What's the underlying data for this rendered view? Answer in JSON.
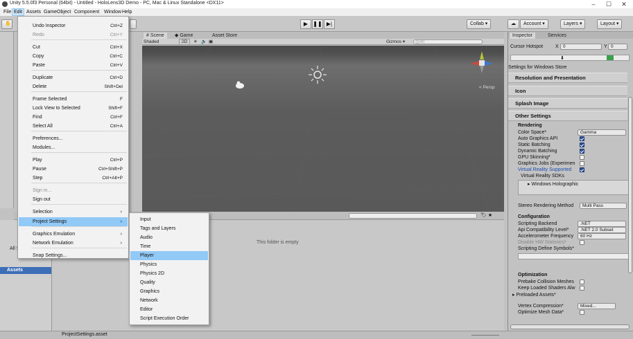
{
  "window": {
    "title": "Unity 5.5.0f3 Personal (64bit) - Untitled - HoloLens3D Demo - PC, Mac & Linux Standalone <DX11>",
    "minimize": "–",
    "maximize": "☐",
    "close": "✕"
  },
  "menubar": [
    "File",
    "Edit",
    "Assets",
    "GameObject",
    "Component",
    "Window",
    "Help"
  ],
  "toolbar": {
    "play": "▶",
    "pause": "❚❚",
    "step": "▶|",
    "collab": "Collab ▾",
    "cloud": "☁",
    "account": "Account ▾",
    "layers": "Layers ▾",
    "layout": "Layout ▾"
  },
  "scene": {
    "tabs": [
      "# Scene",
      "◆ Game",
      "Asset Store"
    ],
    "shading": "Shaded",
    "mode_2d": "2D",
    "gizmos": "Gizmos ▾",
    "search_placeholder": "◎All",
    "persp": "< Persp"
  },
  "project": {
    "empty_text": "This folder is empty",
    "assets_label": "Assets",
    "favorites_item": "All Scripts",
    "status_file": "ProjectSettings.asset"
  },
  "edit_menu": {
    "items": [
      {
        "label": "Undo Inspector",
        "shortcut": "Ctrl+Z",
        "disabled": false
      },
      {
        "label": "Redo",
        "shortcut": "Ctrl+Y",
        "disabled": true
      },
      {
        "label": "Cut",
        "shortcut": "Ctrl+X",
        "disabled": false
      },
      {
        "label": "Copy",
        "shortcut": "Ctrl+C",
        "disabled": false
      },
      {
        "label": "Paste",
        "shortcut": "Ctrl+V",
        "disabled": false
      },
      {
        "label": "Duplicate",
        "shortcut": "Ctrl+D",
        "disabled": false
      },
      {
        "label": "Delete",
        "shortcut": "Shift+Del",
        "disabled": false
      },
      {
        "label": "Frame Selected",
        "shortcut": "F",
        "disabled": false
      },
      {
        "label": "Lock View to Selected",
        "shortcut": "Shift+F",
        "disabled": false
      },
      {
        "label": "Find",
        "shortcut": "Ctrl+F",
        "disabled": false
      },
      {
        "label": "Select All",
        "shortcut": "Ctrl+A",
        "disabled": false
      },
      {
        "label": "Preferences...",
        "shortcut": "",
        "disabled": false
      },
      {
        "label": "Modules...",
        "shortcut": "",
        "disabled": false
      },
      {
        "label": "Play",
        "shortcut": "Ctrl+P",
        "disabled": false
      },
      {
        "label": "Pause",
        "shortcut": "Ctrl+Shift+P",
        "disabled": false
      },
      {
        "label": "Step",
        "shortcut": "Ctrl+Alt+P",
        "disabled": false
      },
      {
        "label": "Sign in...",
        "shortcut": "",
        "disabled": true
      },
      {
        "label": "Sign out",
        "shortcut": "",
        "disabled": false
      },
      {
        "label": "Selection",
        "shortcut": "",
        "disabled": false,
        "submenu": true
      },
      {
        "label": "Project Settings",
        "shortcut": "",
        "disabled": false,
        "submenu": true,
        "hover": true
      },
      {
        "label": "Graphics Emulation",
        "shortcut": "",
        "disabled": false,
        "submenu": true
      },
      {
        "label": "Network Emulation",
        "shortcut": "",
        "disabled": false,
        "submenu": true
      },
      {
        "label": "Snap Settings...",
        "shortcut": "",
        "disabled": false
      }
    ]
  },
  "project_settings_menu": {
    "items": [
      "Input",
      "Tags and Layers",
      "Audio",
      "Time",
      "Player",
      "Physics",
      "Physics 2D",
      "Quality",
      "Graphics",
      "Network",
      "Editor",
      "Script Execution Order"
    ],
    "hover_index": 4
  },
  "inspector": {
    "tabs": [
      "Inspector",
      "Services"
    ],
    "cursor_hotspot": "Cursor Hotspot",
    "x_label": "X",
    "x_value": "0",
    "y_label": "Y",
    "y_value": "0",
    "settings_for": "Settings for Windows Store",
    "sections": {
      "resolution": "Resolution and Presentation",
      "icon": "Icon",
      "splash": "Splash Image",
      "other": "Other Settings"
    },
    "rendering": "Rendering",
    "color_space": "Color Space*",
    "color_space_value": "Gamma",
    "auto_graphics": "Auto Graphics API",
    "static_batching": "Static Batching",
    "dynamic_batching": "Dynamic Batching",
    "gpu_skinning": "GPU Skinning*",
    "graphics_jobs": "Graphics Jobs (Experimen",
    "vr_supported": "Virtual Reality Supported",
    "vr_sdks": "Virtual Reality SDKs",
    "windows_holographic": "▸ Windows Holographic",
    "stereo_method": "Stereo Rendering Method",
    "stereo_value": "Multi Pass",
    "configuration": "Configuration",
    "scripting_backend": "Scripting Backend",
    "scripting_backend_value": ".NET",
    "api_compat": "Api Compatibility Level*",
    "api_compat_value": ".NET 2.0 Subset",
    "accel_freq": "Accelerometer Frequency",
    "accel_value": "60 Hz",
    "disable_hw": "Disable HW Statistics*",
    "define_symbols": "Scripting Define Symbols*",
    "optimization": "Optimization",
    "prebake": "Prebake Collision Meshes",
    "keep_loaded": "Keep Loaded Shaders Alw",
    "preloaded": "▸ Preloaded Assets*",
    "vertex_compression": "Vertex Compression*",
    "vertex_value": "Mixed...",
    "optimize_mesh": "Optimize Mesh Data*"
  }
}
